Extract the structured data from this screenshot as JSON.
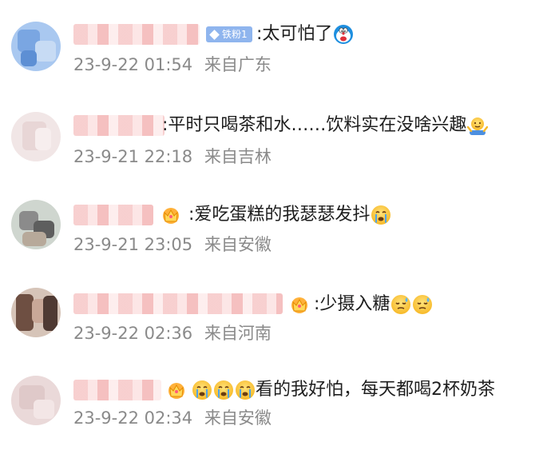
{
  "comments": [
    {
      "badge": "铁粉1",
      "text": ":太可怕了",
      "emoji": "doraemon-icon",
      "time": "23-9-22 01:54",
      "location": "来自广东"
    },
    {
      "text": ":平时只喝茶和水……饮料实在没啥兴趣",
      "emoji": "shrug-icon",
      "time": "23-9-21 22:18",
      "location": "来自吉林"
    },
    {
      "text": ":爱吃蛋糕的我瑟瑟发抖",
      "emoji": "crying-icon",
      "time": "23-9-21 23:05",
      "location": "来自安徽"
    },
    {
      "text": ":少摄入糖",
      "emoji": "sweat-icon",
      "time": "23-9-22 02:36",
      "location": "来自河南"
    },
    {
      "text": "看的我好怕，每天都喝2杯奶茶",
      "emoji": "crying-icon",
      "time": "23-9-22 02:34",
      "location": "来自安徽"
    }
  ],
  "colors": {
    "text": "#1e1e1e",
    "meta": "#8a8a8a",
    "badge": "#8fb5ee",
    "emoji_face": "#ffd447"
  }
}
